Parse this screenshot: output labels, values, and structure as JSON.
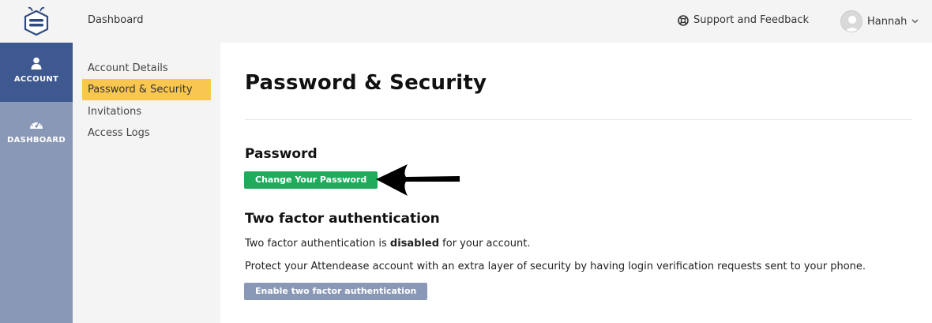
{
  "header": {
    "breadcrumb": "Dashboard",
    "support_label": "Support and Feedback",
    "user_name": "Hannah"
  },
  "rail": {
    "items": [
      {
        "label": "ACCOUNT",
        "icon": "user-icon",
        "active": true
      },
      {
        "label": "DASHBOARD",
        "icon": "speedometer-icon",
        "active": false
      }
    ]
  },
  "subnav": {
    "items": [
      {
        "label": "Account Details",
        "active": false
      },
      {
        "label": "Password & Security",
        "active": true
      },
      {
        "label": "Invitations",
        "active": false
      },
      {
        "label": "Access Logs",
        "active": false
      }
    ]
  },
  "main": {
    "title": "Password & Security",
    "password": {
      "heading": "Password",
      "button_label": "Change Your Password"
    },
    "twofa": {
      "heading": "Two factor authentication",
      "status_prefix": "Two factor authentication is ",
      "status_value": "disabled",
      "status_suffix": " for your account.",
      "description": "Protect your Attendease account with an extra layer of security by having login verification requests sent to your phone.",
      "button_label": "Enable two factor authentication"
    }
  },
  "colors": {
    "rail": "#8a98b7",
    "rail_active": "#3e5890",
    "subnav_active": "#f9c750",
    "primary_button": "#1eac5c",
    "disabled_button": "#8a98b7"
  }
}
